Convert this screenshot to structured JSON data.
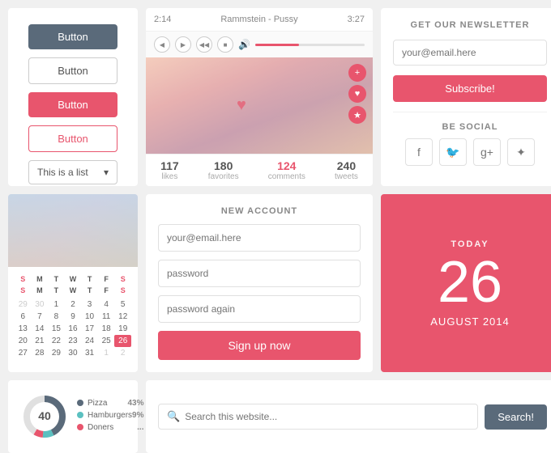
{
  "buttons": {
    "btn1": "Button",
    "btn2": "Button",
    "btn3": "Button",
    "btn4": "Button",
    "dropdown": "This is a list"
  },
  "player": {
    "time_current": "2:14",
    "time_total": "3:27",
    "track": "Rammstein - Pussy",
    "stats": {
      "likes": {
        "value": "117",
        "label": "likes"
      },
      "favorites": {
        "value": "180",
        "label": "favorites"
      },
      "comments": {
        "value": "124",
        "label": "comments"
      },
      "tweets": {
        "value": "240",
        "label": "tweets"
      }
    }
  },
  "newsletter": {
    "title": "GET OUR NEWSLETTER",
    "placeholder": "your@email.here",
    "subscribe_btn": "Subscribe!",
    "social_title": "BE SOCIAL"
  },
  "account": {
    "title": "NEW ACCOUNT",
    "email_placeholder": "your@email.here",
    "password_placeholder": "password",
    "password2_placeholder": "password again",
    "signup_btn": "Sign up now"
  },
  "today": {
    "label": "TODAY",
    "day": "26",
    "month": "AUGUST 2014"
  },
  "calendar": {
    "days": [
      "S",
      "M",
      "T",
      "W",
      "T",
      "F",
      "S",
      "S",
      "M",
      "T",
      "W",
      "T",
      "F",
      "S"
    ],
    "row0": [
      "29",
      "30",
      "1",
      "2",
      "3",
      "4",
      "5"
    ],
    "row1": [
      "6",
      "7",
      "8",
      "9",
      "10",
      "11",
      "12"
    ],
    "row2": [
      "13",
      "14",
      "15",
      "16",
      "17",
      "18",
      "19"
    ],
    "row3": [
      "20",
      "21",
      "22",
      "23",
      "24",
      "25",
      "26"
    ],
    "row4": [
      "27",
      "28",
      "29",
      "30",
      "31",
      "1",
      "2"
    ]
  },
  "chart": {
    "center_value": "40",
    "items": [
      {
        "name": "Pizza",
        "pct": "43%",
        "color": "#5a6a7a"
      },
      {
        "name": "Hamburgers",
        "pct": "9%",
        "color": "#5bc0c0"
      },
      {
        "name": "Doners",
        "pct": "...",
        "color": "#e8556d"
      }
    ]
  },
  "search": {
    "placeholder": "Search this website...",
    "btn_label": "Search!"
  }
}
